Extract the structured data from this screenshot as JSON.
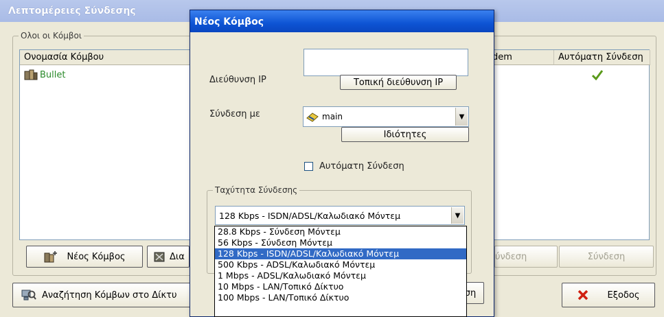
{
  "back_window": {
    "title": "Λεπτομέρειες Σύνδεσης",
    "group_label": "Ολοι οι Κόμβοι",
    "columns": [
      "Ονομασία Κόμβου",
      "dem",
      "Αυτόματη Σύνδεση"
    ],
    "rows": [
      {
        "name": "Bullet",
        "auto_connect": true
      }
    ],
    "buttons": {
      "new_node": "Νέος Κόμβος",
      "delete_partial": "Δια",
      "connection_partial": "ύνδεση",
      "connect": "Σύνδεση",
      "search": "Αναζήτηση Κόμβων στο Δίκτυ",
      "exit": "Εξοδος"
    }
  },
  "dialog": {
    "title": "Νέος Κόμβος",
    "ip_label": "Διεύθυνση IP",
    "ip_value": "",
    "local_ip_button": "Τοπική διεύθυνση IP",
    "connect_with_label": "Σύνδεση με",
    "connect_with_value": "main",
    "properties_button": "Ιδιότητες",
    "auto_connect_label": "Αυτόματη Σύνδεση",
    "auto_connect_checked": false,
    "speed_group_label": "Ταχύτητα Σύνδεσης",
    "speed_selected": "128 Kbps - ISDN/ADSL/Καλωδιακό Μόντεμ",
    "ok_partial": "ση",
    "speed_options": [
      "28.8 Kbps - Σύνδεση Μόντεμ",
      "56 Kbps - Σύνδεση Μόντεμ",
      "128 Kbps - ISDN/ADSL/Καλωδιακό Μόντεμ",
      "500 Kbps - ADSL/Καλωδιακό Μόντεμ",
      "1 Mbps - ADSL/Καλωδιακό Μόντεμ",
      "10 Mbps - LAN/Τοπικό Δίκτυο",
      "100 Mbps - LAN/Τοπικό Δίκτυο"
    ],
    "speed_selected_index": 2
  },
  "colors": {
    "accent": "#316ac5",
    "title_blue": "#0d54d4",
    "node_green": "#2a8a2a"
  }
}
